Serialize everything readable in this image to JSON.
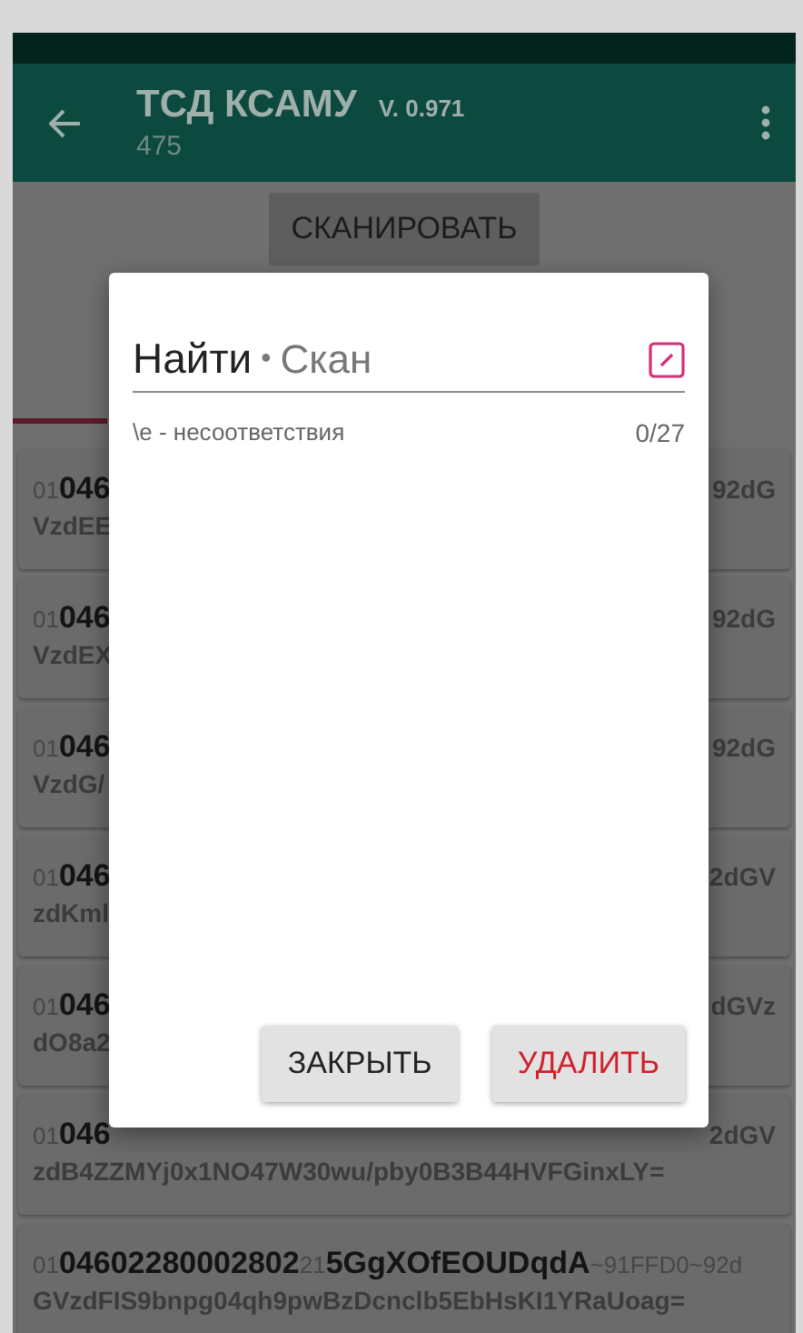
{
  "app_bar": {
    "title": "ТСД КСАМУ",
    "version": "V. 0.971",
    "subtitle": "475"
  },
  "scan_button": "СКАНИРОВАТЬ",
  "codes": [
    {
      "left": [
        {
          "text": "01",
          "kind": "ai"
        },
        {
          "text": "046",
          "kind": "bold"
        }
      ],
      "right": "92dG",
      "line2": "VzdEE"
    },
    {
      "left": [
        {
          "text": "01",
          "kind": "ai"
        },
        {
          "text": "046",
          "kind": "bold"
        }
      ],
      "right": "92dG",
      "line2": "VzdEX"
    },
    {
      "left": [
        {
          "text": "01",
          "kind": "ai"
        },
        {
          "text": "046",
          "kind": "bold"
        }
      ],
      "right": "92dG",
      "line2": "VzdG/"
    },
    {
      "left": [
        {
          "text": "01",
          "kind": "ai"
        },
        {
          "text": "046",
          "kind": "bold"
        }
      ],
      "right": "2dGV",
      "line2": "zdKml"
    },
    {
      "left": [
        {
          "text": "01",
          "kind": "ai"
        },
        {
          "text": "046",
          "kind": "bold"
        }
      ],
      "right": "dGVz",
      "line2": "dO8a2"
    },
    {
      "left": [
        {
          "text": "01",
          "kind": "ai"
        },
        {
          "text": "046",
          "kind": "bold"
        }
      ],
      "right": "2dGV",
      "line2": "zdB4ZZMYj0x1NO47W30wu/pby0B3B44HVFGinxLY="
    },
    {
      "left": [
        {
          "text": "01",
          "kind": "ai"
        },
        {
          "text": "04602280002802",
          "kind": "bold"
        },
        {
          "text": "21",
          "kind": "ai"
        },
        {
          "text": "5GgXOfEOUDqdA",
          "kind": "bold"
        },
        {
          "text": "~91FFD0~92d",
          "kind": "ai"
        }
      ],
      "line2": "GVzdFIS9bnpg04qh9pwBzDcnclb5EbHsKI1YRaUoag="
    }
  ],
  "dialog": {
    "title": "Найти",
    "separator": "•",
    "subtitle": "Скан",
    "filter": "\\e - несоответствия",
    "count": "0/27",
    "buttons": [
      {
        "label": "ЗАКРЫТЬ",
        "kind": "neutral"
      },
      {
        "label": "УДАЛИТЬ",
        "kind": "danger"
      }
    ]
  }
}
